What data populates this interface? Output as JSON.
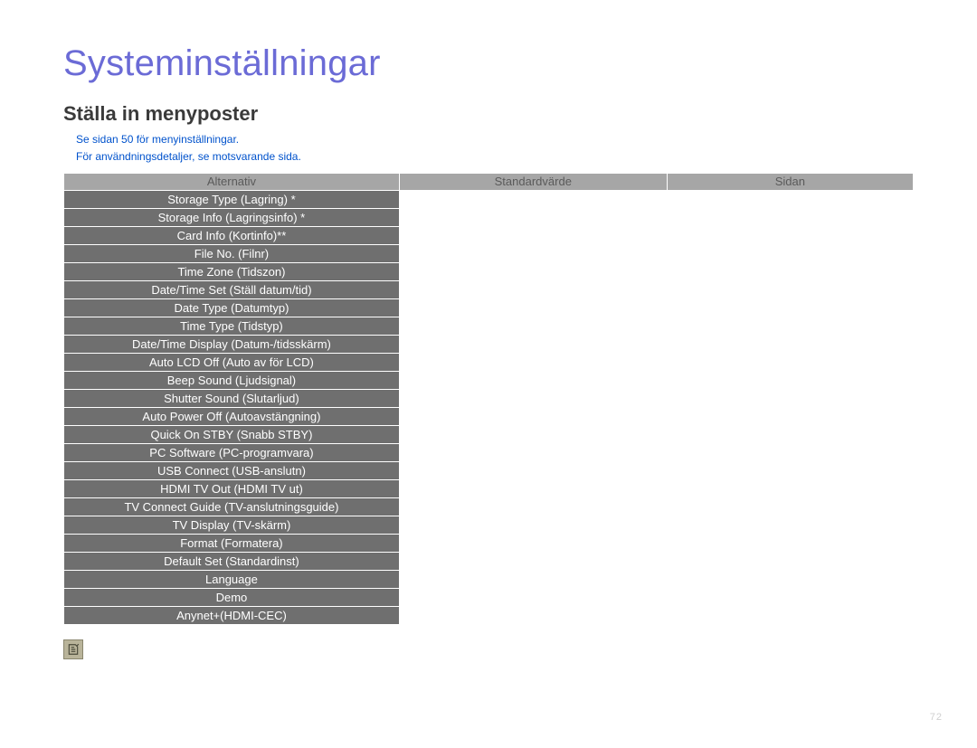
{
  "title": "Systeminställningar",
  "subtitle": "Ställa in menyposter",
  "notes": [
    "Se sidan 50 för menyinställningar.",
    "För användningsdetaljer, se motsvarande sida."
  ],
  "columns": {
    "c1": "Alternativ",
    "c2": "Standardvärde",
    "c3": "Sidan"
  },
  "rows": [
    {
      "option": "Storage Type (Lagring) *"
    },
    {
      "option": "Storage Info (Lagringsinfo) *"
    },
    {
      "option": "Card Info (Kortinfo)**"
    },
    {
      "option": "File No. (Filnr)"
    },
    {
      "option": "Time Zone (Tidszon)"
    },
    {
      "option": "Date/Time Set (Ställ datum/tid)",
      "tall": true
    },
    {
      "option": "Date Type (Datumtyp)"
    },
    {
      "option": "Time Type (Tidstyp)"
    },
    {
      "option": "Date/Time Display (Datum-/tidsskärm)"
    },
    {
      "option": "Auto LCD Off (Auto av för LCD)"
    },
    {
      "option": "Beep Sound (Ljudsignal)"
    },
    {
      "option": "Shutter Sound (Slutarljud)"
    },
    {
      "option": "Auto Power Off (Autoavstängning)"
    },
    {
      "option": "Quick On STBY (Snabb STBY)"
    },
    {
      "option": "PC Software (PC-programvara)"
    },
    {
      "option": "USB Connect (USB-anslutn)"
    },
    {
      "option": "HDMI TV Out (HDMI TV ut)"
    },
    {
      "option": "TV Connect Guide (TV-anslutningsguide)"
    },
    {
      "option": "TV Display (TV-skärm)"
    },
    {
      "option": "Format (Formatera)"
    },
    {
      "option": "Default Set (Standardinst)"
    },
    {
      "option": "Language"
    },
    {
      "option": "Demo"
    },
    {
      "option": "Anynet+(HDMI-CEC)"
    }
  ],
  "pageNumber": "72"
}
